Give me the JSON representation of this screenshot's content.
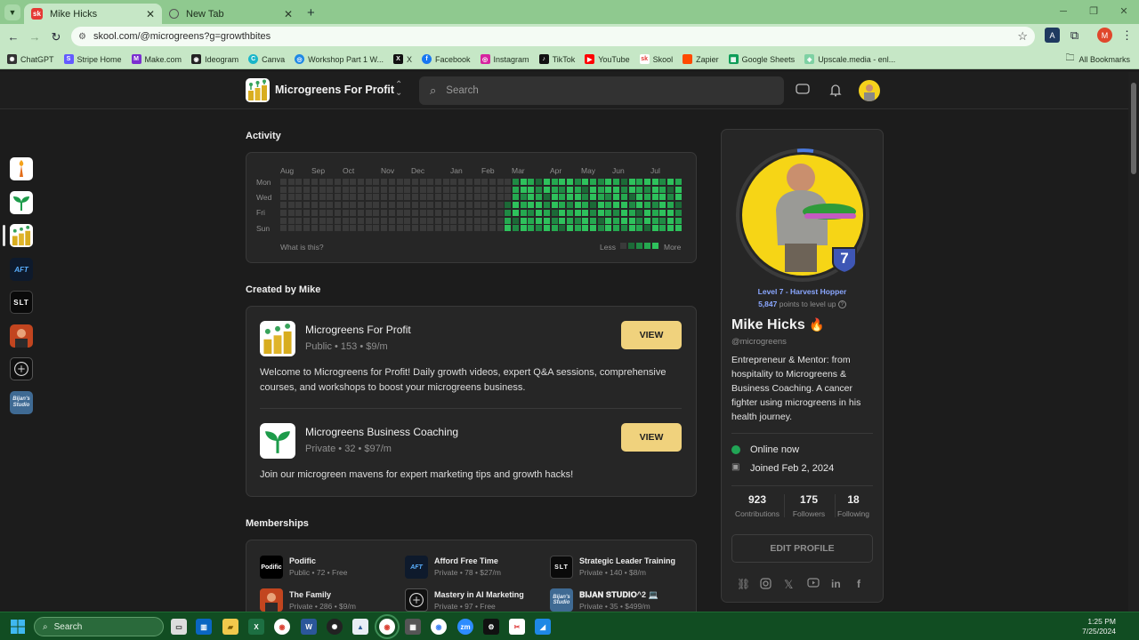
{
  "browser": {
    "tabs": [
      {
        "label": "Mike Hicks",
        "favicon": "sk"
      },
      {
        "label": "New Tab",
        "favicon": "globe-icon"
      }
    ],
    "url": "skool.com/@microgreens?g=growthbites",
    "bookmarks": [
      "ChatGPT",
      "Stripe Home",
      "Make.com",
      "Ideogram",
      "Canva",
      "Workshop Part 1 W...",
      "X",
      "Facebook",
      "Instagram",
      "TikTok",
      "YouTube",
      "Skool",
      "Zapier",
      "Google Sheets",
      "Upscale.media - enl..."
    ],
    "all_bookmarks": "All Bookmarks",
    "profile_initial": "M"
  },
  "header": {
    "group_name": "Microgreens For Profit",
    "search_placeholder": "Search"
  },
  "rail": {
    "items": [
      "torch",
      "sprout",
      "microgreens-for-profit",
      "AFT",
      "SLT",
      "the-family",
      "ai-marketing",
      "Bijan's Studio"
    ],
    "aft_label": "AFT",
    "slt_label": "SLT",
    "bijan_label": "Bijan's Studio"
  },
  "activity": {
    "title": "Activity",
    "months": [
      "Aug",
      "Sep",
      "Oct",
      "Nov",
      "Dec",
      "Jan",
      "Feb",
      "Mar",
      "Apr",
      "May",
      "Jun",
      "Jul"
    ],
    "days": [
      "Mon",
      "Wed",
      "Fri",
      "Sun"
    ],
    "help": "What is this?",
    "less": "Less",
    "more": "More",
    "levels": [
      "#3a3a3a",
      "#1c6a37",
      "#1f8a44",
      "#25a950",
      "#2ec15c"
    ],
    "weeks": 52,
    "active_from_week": 29
  },
  "created": {
    "title": "Created by Mike",
    "groups": [
      {
        "name": "Microgreens For Profit",
        "meta": "Public • 153 • $9/m",
        "desc": "Welcome to Microgreens for Profit! Daily growth videos, expert Q&A sessions, comprehensive courses, and workshops to boost your microgreens business.",
        "button": "VIEW"
      },
      {
        "name": "Microgreens Business Coaching",
        "meta": "Private • 32 • $97/m",
        "desc": "Join our microgreen mavens for expert marketing tips and growth hacks!",
        "button": "VIEW"
      }
    ]
  },
  "memberships": {
    "title": "Memberships",
    "items": [
      {
        "name": "Podific",
        "meta": "Public • 72 • Free",
        "logo": "Podific"
      },
      {
        "name": "Afford Free Time",
        "meta": "Private • 78 • $27/m",
        "logo": "AFT"
      },
      {
        "name": "Strategic Leader Training",
        "meta": "Private • 140 • $8/m",
        "logo": "SLT"
      },
      {
        "name": "The Family",
        "meta": "Private • 286 • $9/m",
        "logo": ""
      },
      {
        "name": "Mastery in AI Marketing",
        "meta": "Private • 97 • Free",
        "logo": ""
      },
      {
        "name": "𝐁𝐈𝐉𝐀𝐍 𝐒𝐓𝐔𝐃𝐈𝐎^2 💻",
        "meta": "Private • 35 • $499/m",
        "logo": "Bijan's Studio"
      }
    ]
  },
  "profile": {
    "level_badge": "7",
    "level_title": "Level 7 - Harvest Hopper",
    "points": "5,847",
    "points_suffix": "points to level up",
    "name": "Mike Hicks",
    "name_emoji": "🔥",
    "handle": "@microgreens",
    "bio": "Entrepreneur & Mentor: from hospitality to Microgreens & Business Coaching. A cancer fighter using microgreens in his health journey.",
    "online": "Online now",
    "joined": "Joined Feb 2, 2024",
    "stats": [
      {
        "num": "923",
        "label": "Contributions"
      },
      {
        "num": "175",
        "label": "Followers"
      },
      {
        "num": "18",
        "label": "Following"
      }
    ],
    "edit_button": "EDIT PROFILE",
    "colors": {
      "online": "#21a556",
      "level": "#8aa7ff",
      "badge": "#3e56b5",
      "avatar_bg": "#f6d516"
    }
  },
  "taskbar": {
    "search": "Search",
    "time": "1:25 PM",
    "date": "7/25/2024"
  }
}
